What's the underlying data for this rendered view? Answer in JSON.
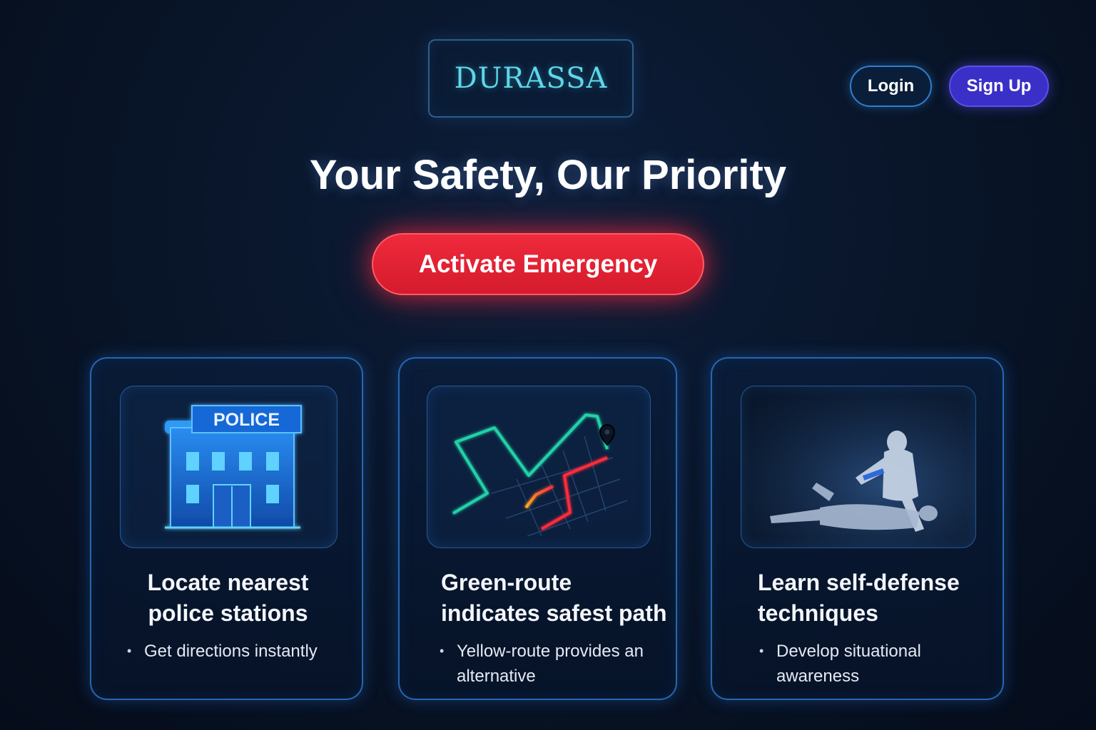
{
  "brand": {
    "logo_text": "DURASSA"
  },
  "header": {
    "login_label": "Login",
    "signup_label": "Sign Up"
  },
  "hero": {
    "headline": "Your Safety, Our Priority",
    "emergency_label": "Activate Emergency"
  },
  "features": [
    {
      "image_label": "POLICE",
      "title_lines": [
        "Locate nearest",
        "police stations"
      ],
      "bullets": [
        "Get directions instantly"
      ],
      "icon": "police-station-icon"
    },
    {
      "title_lines": [
        "Green-route",
        "indicates safest path"
      ],
      "bullets": [
        "Yellow-route provides an alternative"
      ],
      "icon": "route-map-icon"
    },
    {
      "title_lines": [
        "Learn self-defense",
        "techniques"
      ],
      "bullets": [
        "Develop situational awareness"
      ],
      "icon": "self-defense-photo"
    }
  ],
  "colors": {
    "background": "#081427",
    "accent_cyan": "#5fd6e8",
    "login_border": "#2f7fd0",
    "signup_bg": "#3a2fc6",
    "emergency_red": "#e3222f",
    "route_green": "#23d1a6",
    "route_red": "#ff2b3a",
    "route_yellow": "#ffcc33"
  }
}
